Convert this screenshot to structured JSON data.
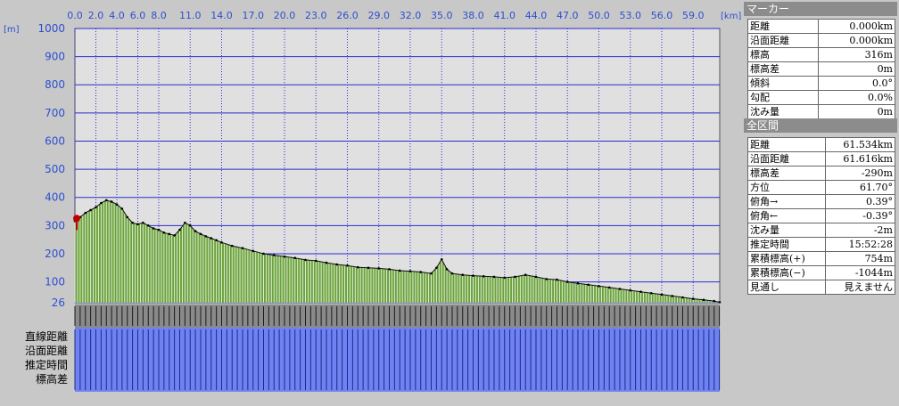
{
  "chart_data": {
    "type": "area",
    "x_unit": "[km]",
    "y_unit": "[m]",
    "x_ticks": [
      "0.0",
      "2.0",
      "4.0",
      "6.0",
      "8.0",
      "11.0",
      "14.0",
      "17.0",
      "20.0",
      "23.0",
      "26.0",
      "29.0",
      "32.0",
      "35.0",
      "38.0",
      "41.0",
      "44.0",
      "47.0",
      "50.0",
      "53.0",
      "56.0",
      "59.0"
    ],
    "x_tick_values": [
      0,
      2,
      4,
      6,
      8,
      11,
      14,
      17,
      20,
      23,
      26,
      29,
      32,
      35,
      38,
      41,
      44,
      47,
      50,
      53,
      56,
      59
    ],
    "xlim": [
      0,
      61.534
    ],
    "y_ticks": [
      "1000",
      "900",
      "800",
      "700",
      "600",
      "500",
      "400",
      "300",
      "200",
      "100",
      "26"
    ],
    "y_tick_values": [
      1000,
      900,
      800,
      700,
      600,
      500,
      400,
      300,
      200,
      100,
      26
    ],
    "ylim": [
      26,
      1000
    ],
    "grid": true,
    "x": [
      0,
      0.5,
      1,
      1.5,
      2,
      2.5,
      3,
      3.5,
      4,
      4.5,
      5,
      5.5,
      6,
      6.5,
      7,
      7.5,
      8,
      8.5,
      9,
      9.5,
      10,
      10.5,
      11,
      11.5,
      12,
      12.5,
      13,
      13.5,
      14,
      15,
      16,
      17,
      18,
      19,
      20,
      21,
      22,
      23,
      24,
      25,
      26,
      27,
      28,
      29,
      30,
      31,
      32,
      33,
      34,
      34.5,
      35,
      35.5,
      36,
      37,
      38,
      39,
      40,
      41,
      42,
      43,
      44,
      45,
      46,
      47,
      48,
      49,
      50,
      51,
      52,
      53,
      54,
      55,
      56,
      57,
      58,
      59,
      60,
      61,
      61.534
    ],
    "elevation": [
      316,
      330,
      345,
      355,
      365,
      380,
      390,
      385,
      375,
      360,
      330,
      310,
      305,
      310,
      300,
      290,
      285,
      275,
      270,
      265,
      285,
      310,
      300,
      280,
      270,
      262,
      255,
      248,
      240,
      228,
      220,
      210,
      200,
      195,
      190,
      185,
      178,
      175,
      168,
      162,
      158,
      152,
      150,
      148,
      145,
      140,
      138,
      135,
      130,
      150,
      180,
      145,
      130,
      125,
      122,
      120,
      118,
      115,
      118,
      125,
      118,
      110,
      108,
      100,
      95,
      90,
      85,
      80,
      75,
      70,
      65,
      60,
      55,
      50,
      45,
      40,
      36,
      32,
      28,
      26
    ]
  },
  "units": {
    "y": "[m]",
    "x": "[km]"
  },
  "row_labels": [
    "直線距離",
    "沿面距離",
    "推定時間",
    "標高差"
  ],
  "marker": {
    "title": "マーカー",
    "rows": [
      {
        "label": "距離",
        "value": "0.000km"
      },
      {
        "label": "沿面距離",
        "value": "0.000km"
      },
      {
        "label": "標高",
        "value": "316m"
      },
      {
        "label": "標高差",
        "value": "0m"
      },
      {
        "label": "傾斜",
        "value": "0.0°"
      },
      {
        "label": "勾配",
        "value": "0.0%"
      },
      {
        "label": "沈み量",
        "value": "0m"
      }
    ]
  },
  "section": {
    "title": "全区間",
    "rows": [
      {
        "label": "距離",
        "value": "61.534km"
      },
      {
        "label": "沿面距離",
        "value": "61.616km"
      },
      {
        "label": "標高差",
        "value": "-290m"
      },
      {
        "label": "方位",
        "value": "61.70°"
      },
      {
        "label": "俯角→",
        "value": "0.39°"
      },
      {
        "label": "俯角←",
        "value": "-0.39°"
      },
      {
        "label": "沈み量",
        "value": "-2m"
      },
      {
        "label": "推定時間",
        "value": "15:52:28"
      },
      {
        "label": "累積標高(+)",
        "value": "754m"
      },
      {
        "label": "累積標高(−)",
        "value": "-1044m"
      },
      {
        "label": "見通し",
        "value": "見えません"
      }
    ]
  },
  "colors": {
    "plot_bg": "#e0e0e0",
    "grid": "#2b2bd0",
    "fill": "#6aa23a",
    "band_gray": "#8a8a8a",
    "band_blue": "#6f82f2",
    "tick_text": "#2d4fd0",
    "start_marker": "#c00000"
  }
}
